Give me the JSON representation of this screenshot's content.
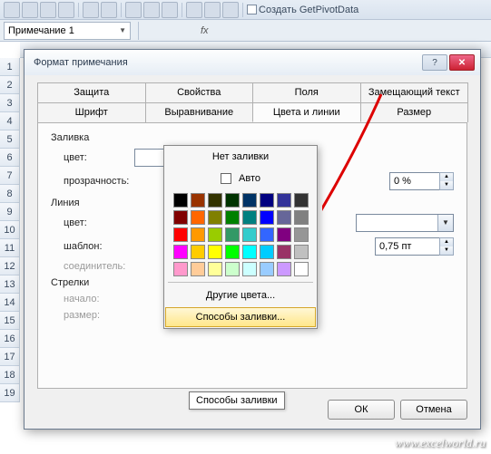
{
  "ribbon": {
    "getpivot": "Создать GetPivotData"
  },
  "namebox": {
    "value": "Примечание 1"
  },
  "fx": "fx",
  "dialog": {
    "title": "Формат примечания",
    "tabs_row1": [
      "Защита",
      "Свойства",
      "Поля",
      "Замещающий текст"
    ],
    "tabs_row2": [
      "Шрифт",
      "Выравнивание",
      "Цвета и линии",
      "Размер"
    ],
    "active_tab": "Цвета и линии"
  },
  "groups": {
    "fill": "Заливка",
    "line": "Линия",
    "arrows": "Стрелки"
  },
  "labels": {
    "color": "цвет:",
    "transparency": "прозрачность:",
    "pattern": "шаблон:",
    "connector": "соединитель:",
    "begin": "начало:",
    "size": "размер:"
  },
  "values": {
    "transparency_pct": "0 %",
    "line_width": "0,75 пт"
  },
  "popup": {
    "no_fill": "Нет заливки",
    "auto": "Авто",
    "more_colors": "Другие цвета...",
    "fill_effects": "Способы заливки..."
  },
  "tooltip": "Способы заливки",
  "buttons": {
    "ok": "ОК",
    "cancel": "Отмена"
  },
  "watermark": "www.excelworld.ru",
  "rowheads": [
    "1",
    "2",
    "3",
    "4",
    "5",
    "6",
    "7",
    "8",
    "9",
    "10",
    "11",
    "12",
    "13",
    "14",
    "15",
    "16",
    "17",
    "18",
    "19"
  ],
  "swatch_colors": [
    "#000000",
    "#993300",
    "#333300",
    "#003300",
    "#003366",
    "#000080",
    "#333399",
    "#333333",
    "#800000",
    "#ff6600",
    "#808000",
    "#008000",
    "#008080",
    "#0000ff",
    "#666699",
    "#808080",
    "#ff0000",
    "#ff9900",
    "#99cc00",
    "#339966",
    "#33cccc",
    "#3366ff",
    "#800080",
    "#969696",
    "#ff00ff",
    "#ffcc00",
    "#ffff00",
    "#00ff00",
    "#00ffff",
    "#00ccff",
    "#993366",
    "#c0c0c0",
    "#ff99cc",
    "#ffcc99",
    "#ffff99",
    "#ccffcc",
    "#ccffff",
    "#99ccff",
    "#cc99ff",
    "#ffffff"
  ]
}
